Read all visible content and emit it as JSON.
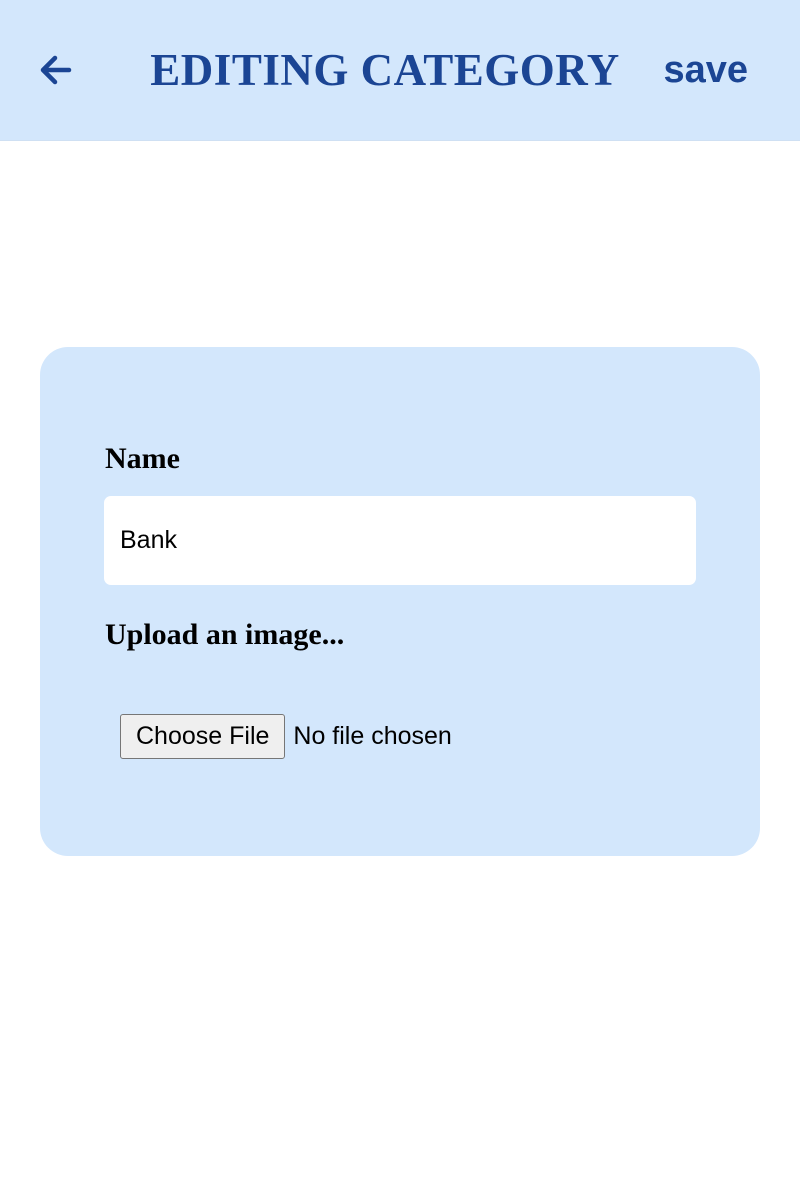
{
  "header": {
    "title": "EDITING CATEGORY",
    "save_label": "save",
    "back_icon": "arrow-left-icon"
  },
  "form": {
    "name_label": "Name",
    "name_value": "Bank",
    "upload_label": "Upload an image...",
    "choose_file_label": "Choose File",
    "file_status": "No file chosen"
  },
  "colors": {
    "header_bg": "#d3e7fc",
    "card_bg": "#d3e7fc",
    "accent": "#1b4594"
  }
}
